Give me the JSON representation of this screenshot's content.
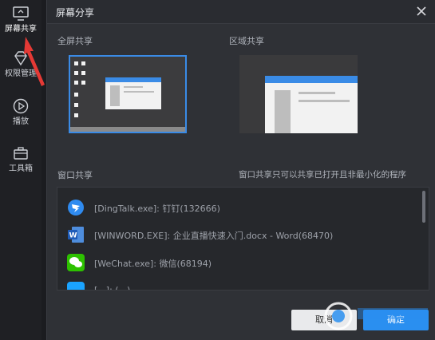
{
  "sidebar": {
    "items": [
      {
        "label": "屏幕共享",
        "icon": "monitor-icon"
      },
      {
        "label": "权限管理",
        "icon": "diamond-icon"
      },
      {
        "label": "播放",
        "icon": "play-icon"
      },
      {
        "label": "工具箱",
        "icon": "toolbox-icon"
      }
    ]
  },
  "dialog": {
    "title": "屏幕分享",
    "full_screen_label": "全屏共享",
    "region_label": "区域共享",
    "window_label": "窗口共享",
    "window_hint": "窗口共享只可以共享已打开且非最小化的程序",
    "windows": [
      {
        "text": "[DingTalk.exe]: 钉钉(132666)",
        "icon": "dingtalk-icon"
      },
      {
        "text": "[WINWORD.EXE]: 企业直播快速入门.docx - Word(68470)",
        "icon": "word-icon"
      },
      {
        "text": "[WeChat.exe]: 微信(68194)",
        "icon": "wechat-icon"
      },
      {
        "text": "[...]: (...)",
        "icon": "app-icon"
      }
    ],
    "cancel_label": "取消",
    "ok_label": "确定"
  },
  "colors": {
    "accent": "#2a8ff0",
    "annotation": "#e53935"
  }
}
